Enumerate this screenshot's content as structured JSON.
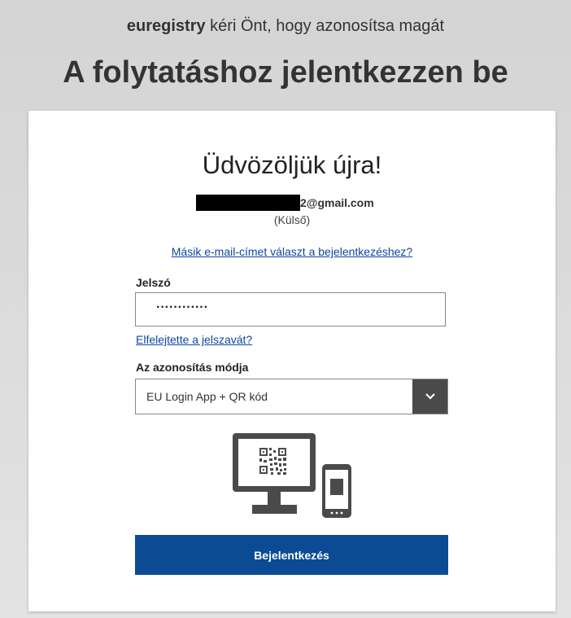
{
  "header": {
    "app_name": "euregistry",
    "intro_rest": " kéri Önt, hogy azonosítsa magát",
    "title": "A folytatáshoz jelentkezzen be"
  },
  "card": {
    "welcome": "Üdvözöljük újra!",
    "email_suffix": "2@gmail.com",
    "account_type": "(Külső)",
    "other_email_link": "Másik e-mail-címet választ a bejelentkezéshez?",
    "password_label": "Jelszó",
    "password_value": "············",
    "forgot_link": "Elfelejtette a jelszavát?",
    "method_label": "Az azonosítás módja",
    "method_value": "EU Login App + QR kód",
    "login_button": "Bejelentkezés"
  },
  "colors": {
    "button": "#0b4b93",
    "link": "#0e47a1",
    "select_arrow_bg": "#4a4a4a"
  },
  "icons": {
    "dropdown": "chevron-down-icon",
    "illustration": "monitor-qr-phone-icon"
  }
}
